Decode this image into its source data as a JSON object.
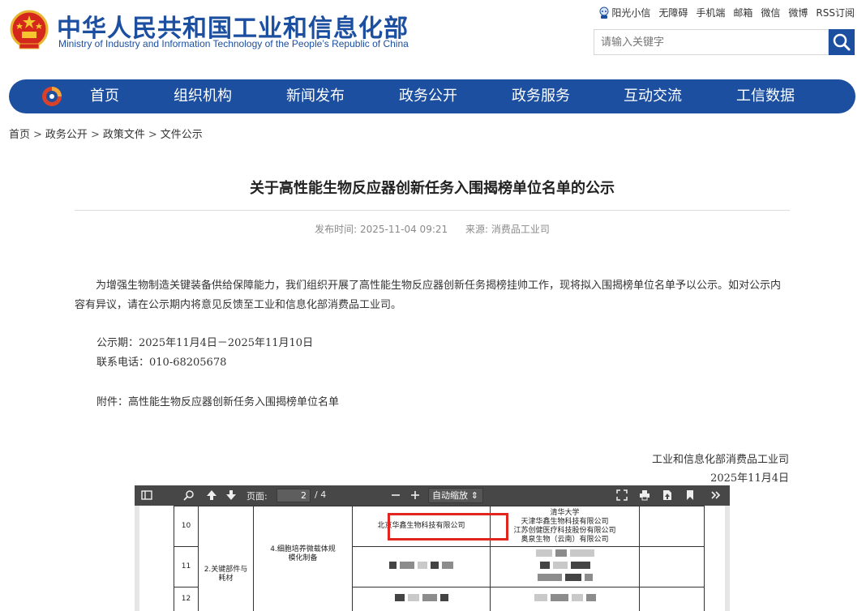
{
  "header": {
    "title": "中华人民共和国工业和信息化部",
    "subtitle": "Ministry of Industry and Information Technology of the People’s Republic of China",
    "toplinks": [
      "阳光小信",
      "无障碍",
      "手机端",
      "邮箱",
      "微信",
      "微博",
      "RSS订阅"
    ],
    "search_placeholder": "请输入关键字",
    "brand_color": "#1d4fa0"
  },
  "nav": {
    "items": [
      "首页",
      "组织机构",
      "新闻发布",
      "政务公开",
      "政务服务",
      "互动交流",
      "工信数据"
    ]
  },
  "breadcrumb": [
    "首页",
    "政务公开",
    "政策文件",
    "文件公示"
  ],
  "article": {
    "title": "关于高性能生物反应器创新任务入围揭榜单位名单的公示",
    "publish_label": "发布时间:",
    "publish_time": "2025-11-04 09:21",
    "source_label": "来源:",
    "source": "消费品工业司",
    "paragraph": "为增强生物制造关键装备供给保障能力，我们组织开展了高性能生物反应器创新任务揭榜挂帅工作，现将拟入围揭榜单位名单予以公示。如对公示内容有异议，请在公示期内将意见反馈至工业和信息化部消费品工业司。",
    "period": "公示期：2025年11月4日－2025年11月10日",
    "phone": "联系电话：010-68205678",
    "attachment": "附件：高性能生物反应器创新任务入围揭榜单位名单",
    "signature_org": "工业和信息化部消费品工业司",
    "signature_date": "2025年11月4日"
  },
  "pdf_viewer": {
    "page_label": "页面:",
    "current_page": "2",
    "total_pages": "/ 4",
    "zoom": "自动缩放",
    "rows": [
      {
        "no": "10",
        "applicant": "北京华鑫生物科技有限公司",
        "partners": [
          "清华大学",
          "天津华鑫生物科技有限公司",
          "江苏创健医疗科技股份有限公司",
          "奥泉生物（云南）有限公司"
        ]
      },
      {
        "no": "11"
      },
      {
        "no": "12"
      }
    ],
    "category": "2.关键部件与耗材",
    "task": "4.细胞培养微载体规模化制备",
    "highlight_color": "#e0261e"
  }
}
